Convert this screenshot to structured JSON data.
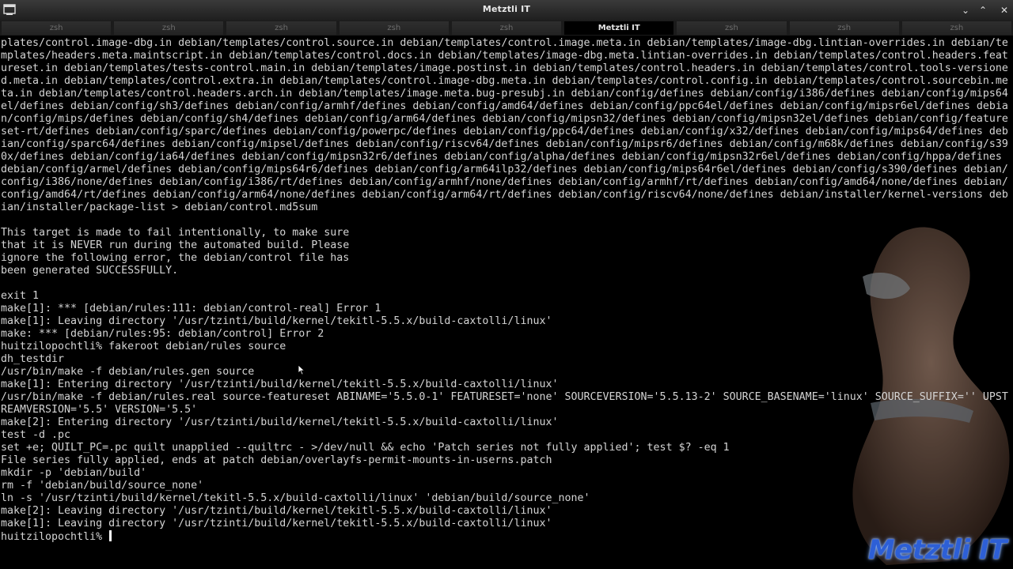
{
  "window": {
    "title": "Metztli IT",
    "controls": {
      "menu": "⌄",
      "maximize": "⌃",
      "close": "✕"
    }
  },
  "tabs": [
    {
      "label": "zsh",
      "active": false
    },
    {
      "label": "zsh",
      "active": false
    },
    {
      "label": "zsh",
      "active": false
    },
    {
      "label": "zsh",
      "active": false
    },
    {
      "label": "zsh",
      "active": false
    },
    {
      "label": "Metztli IT",
      "active": true
    },
    {
      "label": "zsh",
      "active": false
    },
    {
      "label": "zsh",
      "active": false
    },
    {
      "label": "zsh",
      "active": false
    }
  ],
  "terminal": {
    "lines": [
      "plates/control.image-dbg.in debian/templates/control.source.in debian/templates/control.image.meta.in debian/templates/image-dbg.lintian-overrides.in debian/templates/headers.meta.maintscript.in debian/templates/control.docs.in debian/templates/image-dbg.meta.lintian-overrides.in debian/templates/control.headers.featureset.in debian/templates/tests-control.main.in debian/templates/image.postinst.in debian/templates/control.headers.in debian/templates/control.tools-versioned.meta.in debian/templates/control.extra.in debian/templates/control.image-dbg.meta.in debian/templates/control.config.in debian/templates/control.sourcebin.meta.in debian/templates/control.headers.arch.in debian/templates/image.meta.bug-presubj.in debian/config/defines debian/config/i386/defines debian/config/mips64el/defines debian/config/sh3/defines debian/config/armhf/defines debian/config/amd64/defines debian/config/ppc64el/defines debian/config/mipsr6el/defines debian/config/mips/defines debian/config/sh4/defines debian/config/arm64/defines debian/config/mipsn32/defines debian/config/mipsn32el/defines debian/config/featureset-rt/defines debian/config/sparc/defines debian/config/powerpc/defines debian/config/ppc64/defines debian/config/x32/defines debian/config/mips64/defines debian/config/sparc64/defines debian/config/mipsel/defines debian/config/riscv64/defines debian/config/mipsr6/defines debian/config/m68k/defines debian/config/s390x/defines debian/config/ia64/defines debian/config/mipsn32r6/defines debian/config/alpha/defines debian/config/mipsn32r6el/defines debian/config/hppa/defines debian/config/armel/defines debian/config/mips64r6/defines debian/config/arm64ilp32/defines debian/config/mips64r6el/defines debian/config/s390/defines debian/config/i386/none/defines debian/config/i386/rt/defines debian/config/armhf/none/defines debian/config/armhf/rt/defines debian/config/amd64/none/defines debian/config/amd64/rt/defines debian/config/arm64/none/defines debian/config/arm64/rt/defines debian/config/riscv64/none/defines debian/installer/kernel-versions debian/installer/package-list > debian/control.md5sum",
      "",
      "This target is made to fail intentionally, to make sure",
      "that it is NEVER run during the automated build. Please",
      "ignore the following error, the debian/control file has",
      "been generated SUCCESSFULLY.",
      "",
      "exit 1",
      "make[1]: *** [debian/rules:111: debian/control-real] Error 1",
      "make[1]: Leaving directory '/usr/tzinti/build/kernel/tekitl-5.5.x/build-caxtolli/linux'",
      "make: *** [debian/rules:95: debian/control] Error 2",
      "huitzilopochtli% fakeroot debian/rules source",
      "dh_testdir",
      "/usr/bin/make -f debian/rules.gen source",
      "make[1]: Entering directory '/usr/tzinti/build/kernel/tekitl-5.5.x/build-caxtolli/linux'",
      "/usr/bin/make -f debian/rules.real source-featureset ABINAME='5.5.0-1' FEATURESET='none' SOURCEVERSION='5.5.13-2' SOURCE_BASENAME='linux' SOURCE_SUFFIX='' UPSTREAMVERSION='5.5' VERSION='5.5'",
      "make[2]: Entering directory '/usr/tzinti/build/kernel/tekitl-5.5.x/build-caxtolli/linux'",
      "test -d .pc",
      "set +e; QUILT_PC=.pc quilt unapplied --quiltrc - >/dev/null && echo 'Patch series not fully applied'; test $? -eq 1",
      "File series fully applied, ends at patch debian/overlayfs-permit-mounts-in-userns.patch",
      "mkdir -p 'debian/build'",
      "rm -f 'debian/build/source_none'",
      "ln -s '/usr/tzinti/build/kernel/tekitl-5.5.x/build-caxtolli/linux' 'debian/build/source_none'",
      "make[2]: Leaving directory '/usr/tzinti/build/kernel/tekitl-5.5.x/build-caxtolli/linux'",
      "make[1]: Leaving directory '/usr/tzinti/build/kernel/tekitl-5.5.x/build-caxtolli/linux'"
    ],
    "prompt": "huitzilopochtli% "
  },
  "branding": {
    "logo_text": "Metztli IT"
  },
  "icons": {
    "app_icon": "terminal-window-icon",
    "pointer": "mouse-pointer-icon"
  },
  "colors": {
    "background": "#000000",
    "text": "#d4d4d4",
    "logo": "#2d5fd6",
    "tab_active": "#000000",
    "tab_inactive": "#2a2a2a"
  }
}
